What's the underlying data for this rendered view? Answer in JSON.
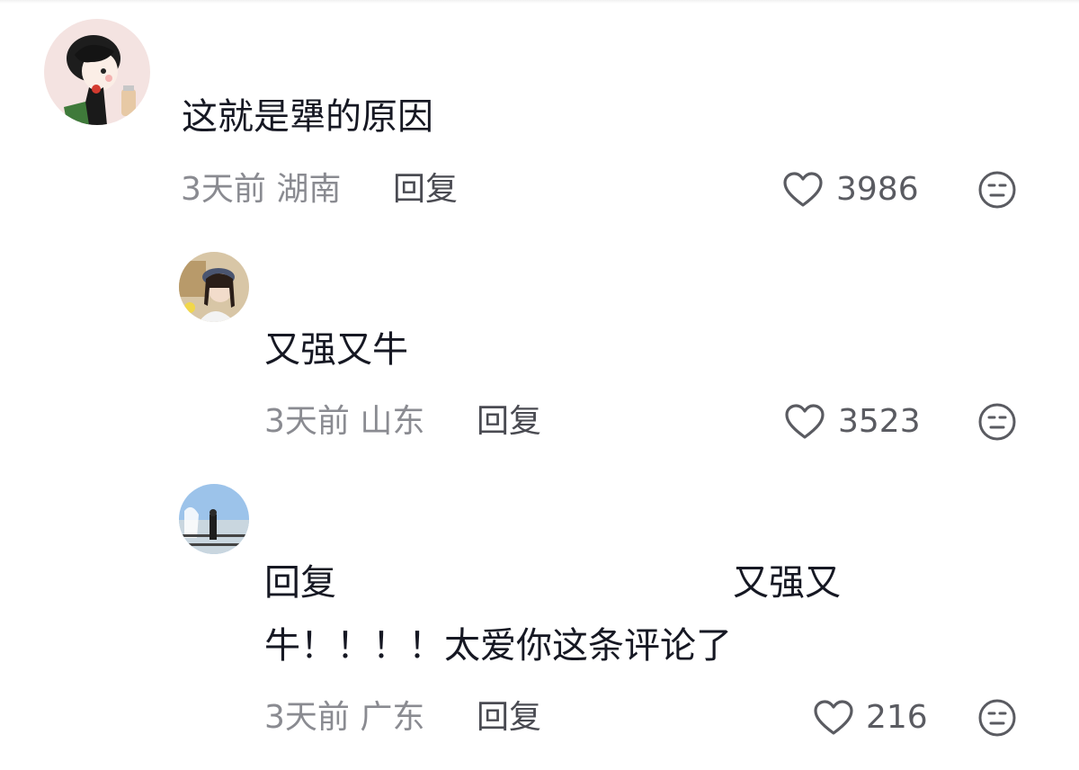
{
  "comments": [
    {
      "text": "这就是犟的原因",
      "time_location": "3天前 湖南",
      "reply_label": "回复",
      "likes": "3986",
      "like_icon": "heart-outline-icon",
      "dislike_icon": "neutral-face-icon"
    },
    {
      "text": "又强又牛",
      "time_location": "3天前 山东",
      "reply_label": "回复",
      "likes": "3523",
      "like_icon": "heart-outline-icon",
      "dislike_icon": "neutral-face-icon"
    },
    {
      "text_line1_prefix": "回复",
      "text_line1_quote": "又强又",
      "text_line2": "牛！！！！太爱你这条评论了",
      "time_location": "3天前 广东",
      "reply_label": "回复",
      "likes": "216",
      "like_icon": "heart-outline-icon",
      "dislike_icon": "neutral-face-icon"
    }
  ],
  "colors": {
    "text_primary": "#161823",
    "text_meta": "#8a8b91",
    "reply": "#4a4b52",
    "icon": "#5a5b61"
  }
}
